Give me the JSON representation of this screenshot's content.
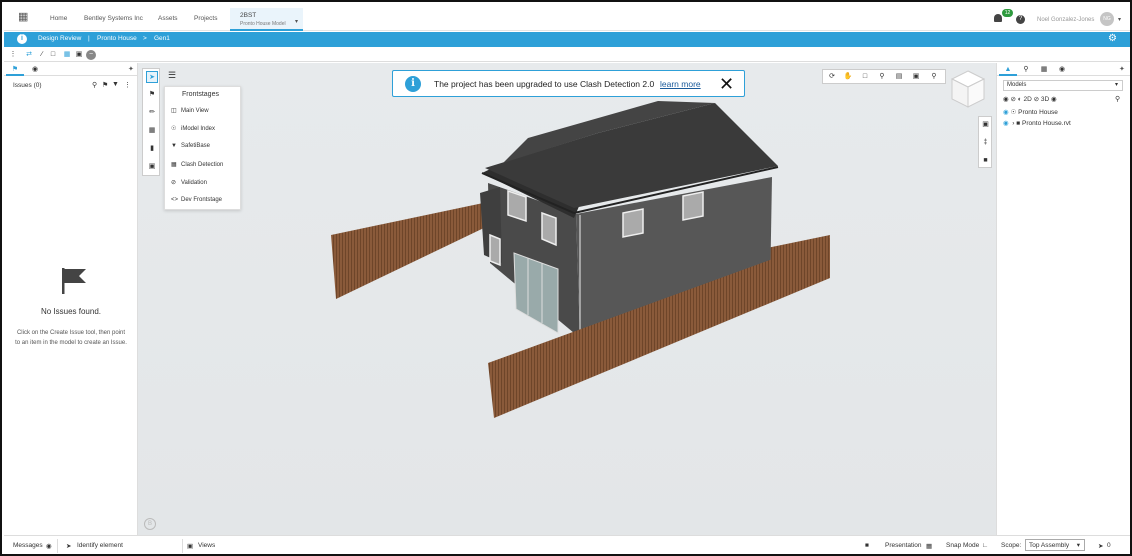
{
  "topbar": {
    "nav": [
      "Home",
      "Bentley Systems Inc",
      "Assets",
      "Projects"
    ],
    "active_tab": {
      "title": "2BST",
      "subtitle": "Pronto House Model"
    },
    "notification_count": "12",
    "user_name": "Noel Gonzalez-Jones",
    "avatar_initials": "NG"
  },
  "breadcrumb": {
    "items": [
      "Design Review",
      "Pronto House",
      "Gen1"
    ]
  },
  "left_panel": {
    "issues_title": "Issues (0)",
    "empty_title": "No Issues found.",
    "empty_hint": "Click on the Create Issue tool, then point to an item in the model to create an Issue."
  },
  "frontstage_menu": {
    "title": "Frontstages",
    "items": [
      {
        "label": "Main View",
        "icon": "main-view-icon"
      },
      {
        "label": "iModel Index",
        "icon": "imodel-index-icon"
      },
      {
        "label": "SafetiBase",
        "icon": "safetibase-icon"
      },
      {
        "label": "Clash Detection",
        "icon": "clash-detection-icon"
      },
      {
        "label": "Validation",
        "icon": "validation-icon"
      },
      {
        "label": "Dev Frontstage",
        "icon": "dev-frontstage-icon"
      }
    ]
  },
  "toast": {
    "message": "The project has been upgraded to use Clash Detection 2.0",
    "link": "learn more"
  },
  "right_panel": {
    "models_label": "Models",
    "view_2d": "2D",
    "view_3d": "3D",
    "tree": [
      {
        "label": "Pronto House"
      },
      {
        "label": "Pronto House.rvt"
      }
    ]
  },
  "statusbar": {
    "messages": "Messages",
    "identify": "Identify element",
    "views": "Views",
    "presentation": "Presentation",
    "snap_mode": "Snap Mode",
    "scope_label": "Scope:",
    "scope_value": "Top Assembly",
    "selection_count": "0"
  },
  "colors": {
    "accent": "#2ea0d8",
    "roof": "#3c3c3c",
    "walls": "#555555",
    "fence": "#8a5a3a",
    "notification": "#2e9a3e"
  }
}
